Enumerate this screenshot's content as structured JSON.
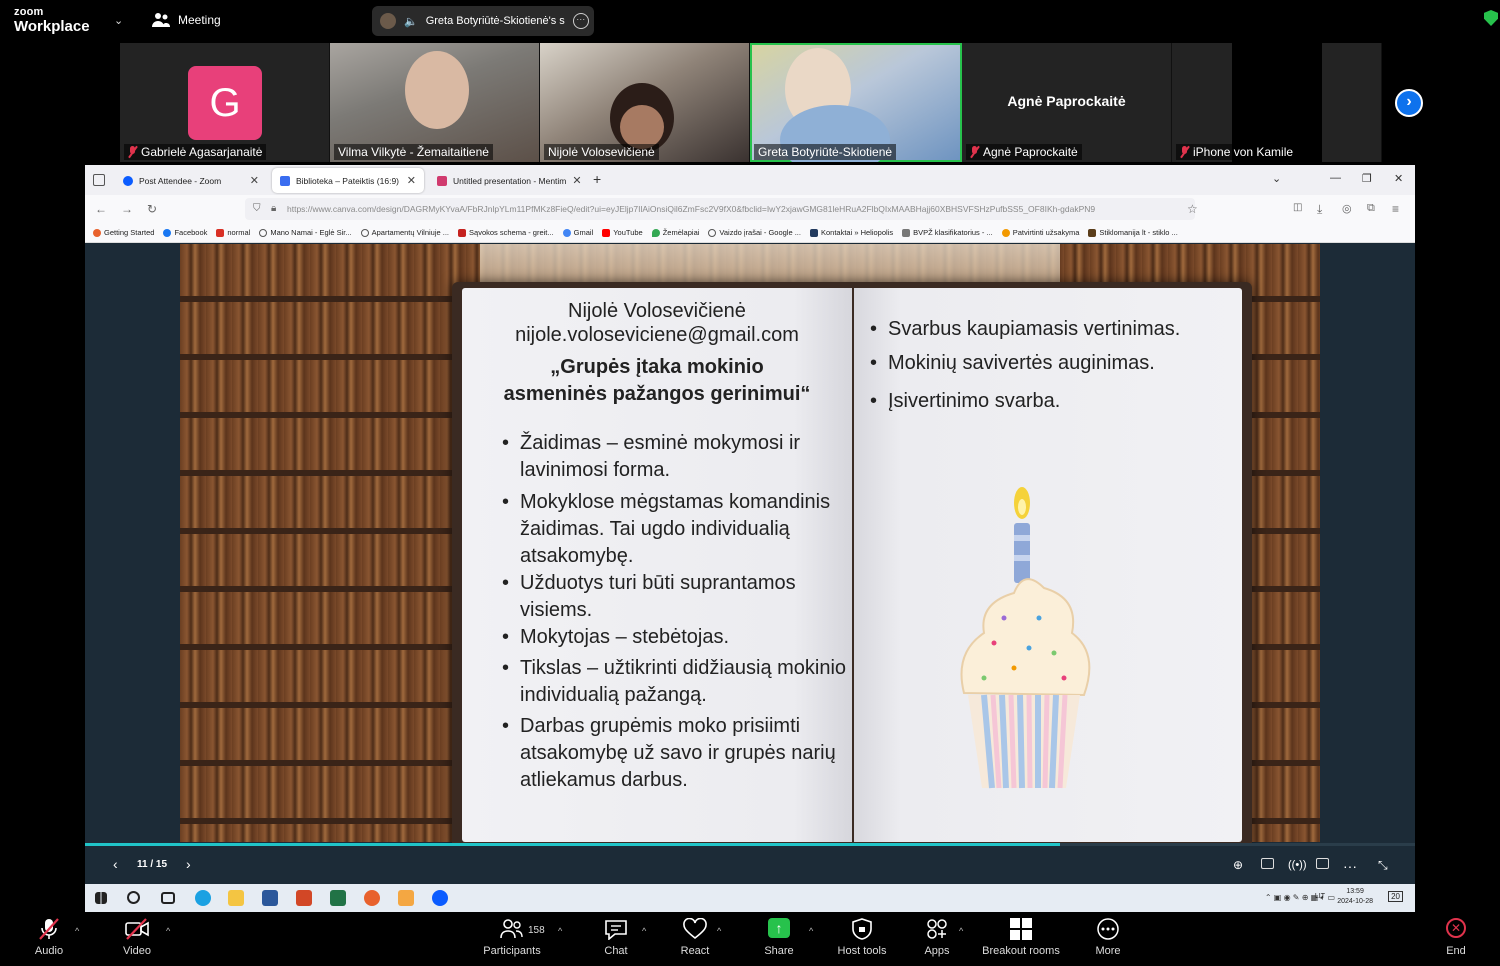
{
  "app": {
    "logo_line1": "zoom",
    "logo_line2": "Workplace",
    "meeting_label": "Meeting",
    "active_speaker": "Greta Botyriūtė-Skiotienė's s"
  },
  "gallery": [
    {
      "name": "Gabrielė Agasarjanaitė",
      "initial": "G",
      "muted": true
    },
    {
      "name": "Vilma Vilkytė - Žemaitaitienė",
      "muted": false
    },
    {
      "name": "Nijolė Volosevičienė",
      "muted": false
    },
    {
      "name": "Greta Botyriūtė-Skiotienė",
      "muted": false,
      "active": true
    },
    {
      "name": "Agnė Paprockaitė",
      "display_name": "Agnė Paprockaitė",
      "muted": true
    },
    {
      "name": "iPhone von Kamile",
      "muted": true
    }
  ],
  "browser": {
    "tabs": [
      {
        "label": "Post Attendee - Zoom"
      },
      {
        "label": "Biblioteka – Pateiktis (16:9)"
      },
      {
        "label": "Untitled presentation - Mentim"
      }
    ],
    "url": "https://www.canva.com/design/DAGRMyKYvaA/FbRJnlpYLm11PfMKz8FieQ/edit?ui=eyJEljp7IlAiOnsiQil6ZmFsc2V9fX0&fbclid=IwY2xjawGMG81leHRuA2FlbQIxMAABHajj60XBHSVFSHzPufbSS5_OF8IKh-gdakPN9",
    "bookmarks": [
      "Getting Started",
      "Facebook",
      "normal",
      "Mano Namai - Eglė Sir...",
      "Apartamentų Vilniuje ...",
      "Sąvokos schema - greit...",
      "Gmail",
      "YouTube",
      "Žemėlapiai",
      "Vaizdo įrašai - Google ...",
      "Kontaktai » Heliopolis",
      "BVPŽ klasifikatorius - ...",
      "Patvirtinti užsakyma",
      "Stiklomanija lt - stiklo ..."
    ]
  },
  "slide": {
    "author": "Nijolė Volosevičienė",
    "email": "nijole.voloseviciene@gmail.com",
    "title_line1": "„Grupės įtaka mokinio",
    "title_line2": "asmeninės pažangos gerinimui“",
    "left_bullets": [
      "Žaidimas – esminė mokymosi ir lavinimosi forma.",
      "Mokyklose mėgstamas komandinis žaidimas. Tai ugdo individualią atsakomybę.",
      "Užduotys turi būti suprantamos visiems.",
      "Mokytojas – stebėtojas.",
      "Tikslas – užtikrinti didžiausią mokinio individualią pažangą.",
      "Darbas grupėmis moko prisiimti atsakomybę už savo ir grupės narių atliekamus darbus."
    ],
    "right_bullets": [
      "Svarbus kaupiamasis vertinimas.",
      "Mokinių savivertės auginimas.",
      "Įsivertinimo svarba."
    ],
    "page_indicator": "11 / 15",
    "progress_fraction": 0.733
  },
  "taskbar": {
    "time": "13:59",
    "date": "2024-10-28",
    "lang": "LIT",
    "notif": "20"
  },
  "toolbar": {
    "audio": "Audio",
    "video": "Video",
    "participants": "Participants",
    "participants_count": "158",
    "chat": "Chat",
    "react": "React",
    "share": "Share",
    "host_tools": "Host tools",
    "apps": "Apps",
    "breakout": "Breakout rooms",
    "more": "More",
    "end": "End"
  }
}
